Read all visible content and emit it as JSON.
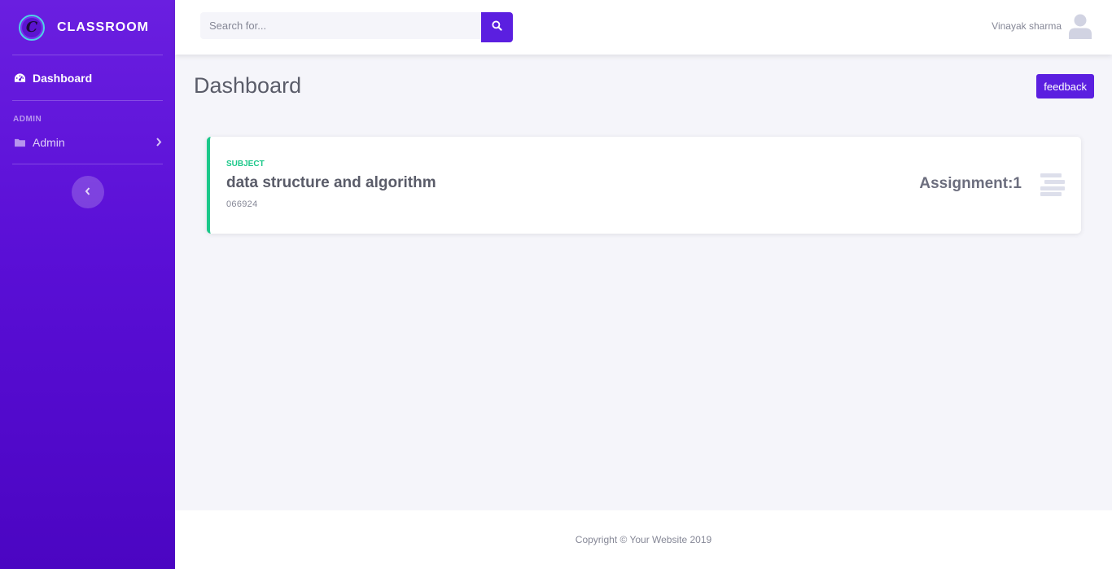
{
  "brand": {
    "name": "CLASSROOM",
    "logo_letter": "C"
  },
  "sidebar": {
    "items": [
      {
        "label": "Dashboard",
        "icon": "tachometer-icon",
        "active": true
      }
    ],
    "heading": "ADMIN",
    "admin_item": {
      "label": "Admin",
      "icon": "folder-icon"
    },
    "toggle_icon": "chevron-left-icon"
  },
  "topbar": {
    "search_placeholder": "Search for...",
    "search_value": "",
    "search_icon": "search-icon",
    "user_name": "Vinayak sharma",
    "avatar_icon": "user-icon"
  },
  "main": {
    "title": "Dashboard",
    "feedback_label": "feedback",
    "cards": [
      {
        "kicker": "SUBJECT",
        "title": "data structure and algorithm",
        "code": "066924",
        "stat": "Assignment:1",
        "icon": "bars-icon"
      }
    ]
  },
  "footer": {
    "text": "Copyright © Your Website 2019"
  },
  "colors": {
    "primary": "#5b1fe0",
    "success": "#1cc88a",
    "text": "#5a5c69",
    "muted": "#858796"
  }
}
